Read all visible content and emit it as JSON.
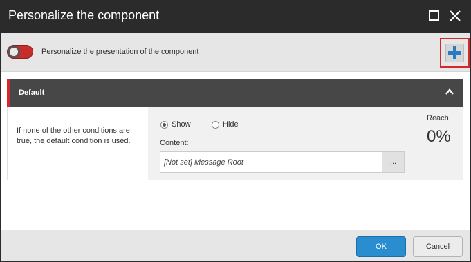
{
  "dialog": {
    "title": "Personalize the component"
  },
  "toolbar": {
    "description": "Personalize the presentation of the component",
    "toggle_state": "on",
    "add_icon": "plus-icon"
  },
  "condition": {
    "name": "Default",
    "description": "If none of the other conditions are true, the default condition is used.",
    "show_label": "Show",
    "hide_label": "Hide",
    "selected": "Show",
    "content_label": "Content:",
    "content_value": "[Not set] Message Root",
    "browse_label": "...",
    "reach_label": "Reach",
    "reach_value": "0%"
  },
  "footer": {
    "ok_label": "OK",
    "cancel_label": "Cancel"
  },
  "colors": {
    "accent_red": "#d4272e",
    "primary_blue": "#2a8dd0",
    "header_dark": "#2b2b2b"
  }
}
